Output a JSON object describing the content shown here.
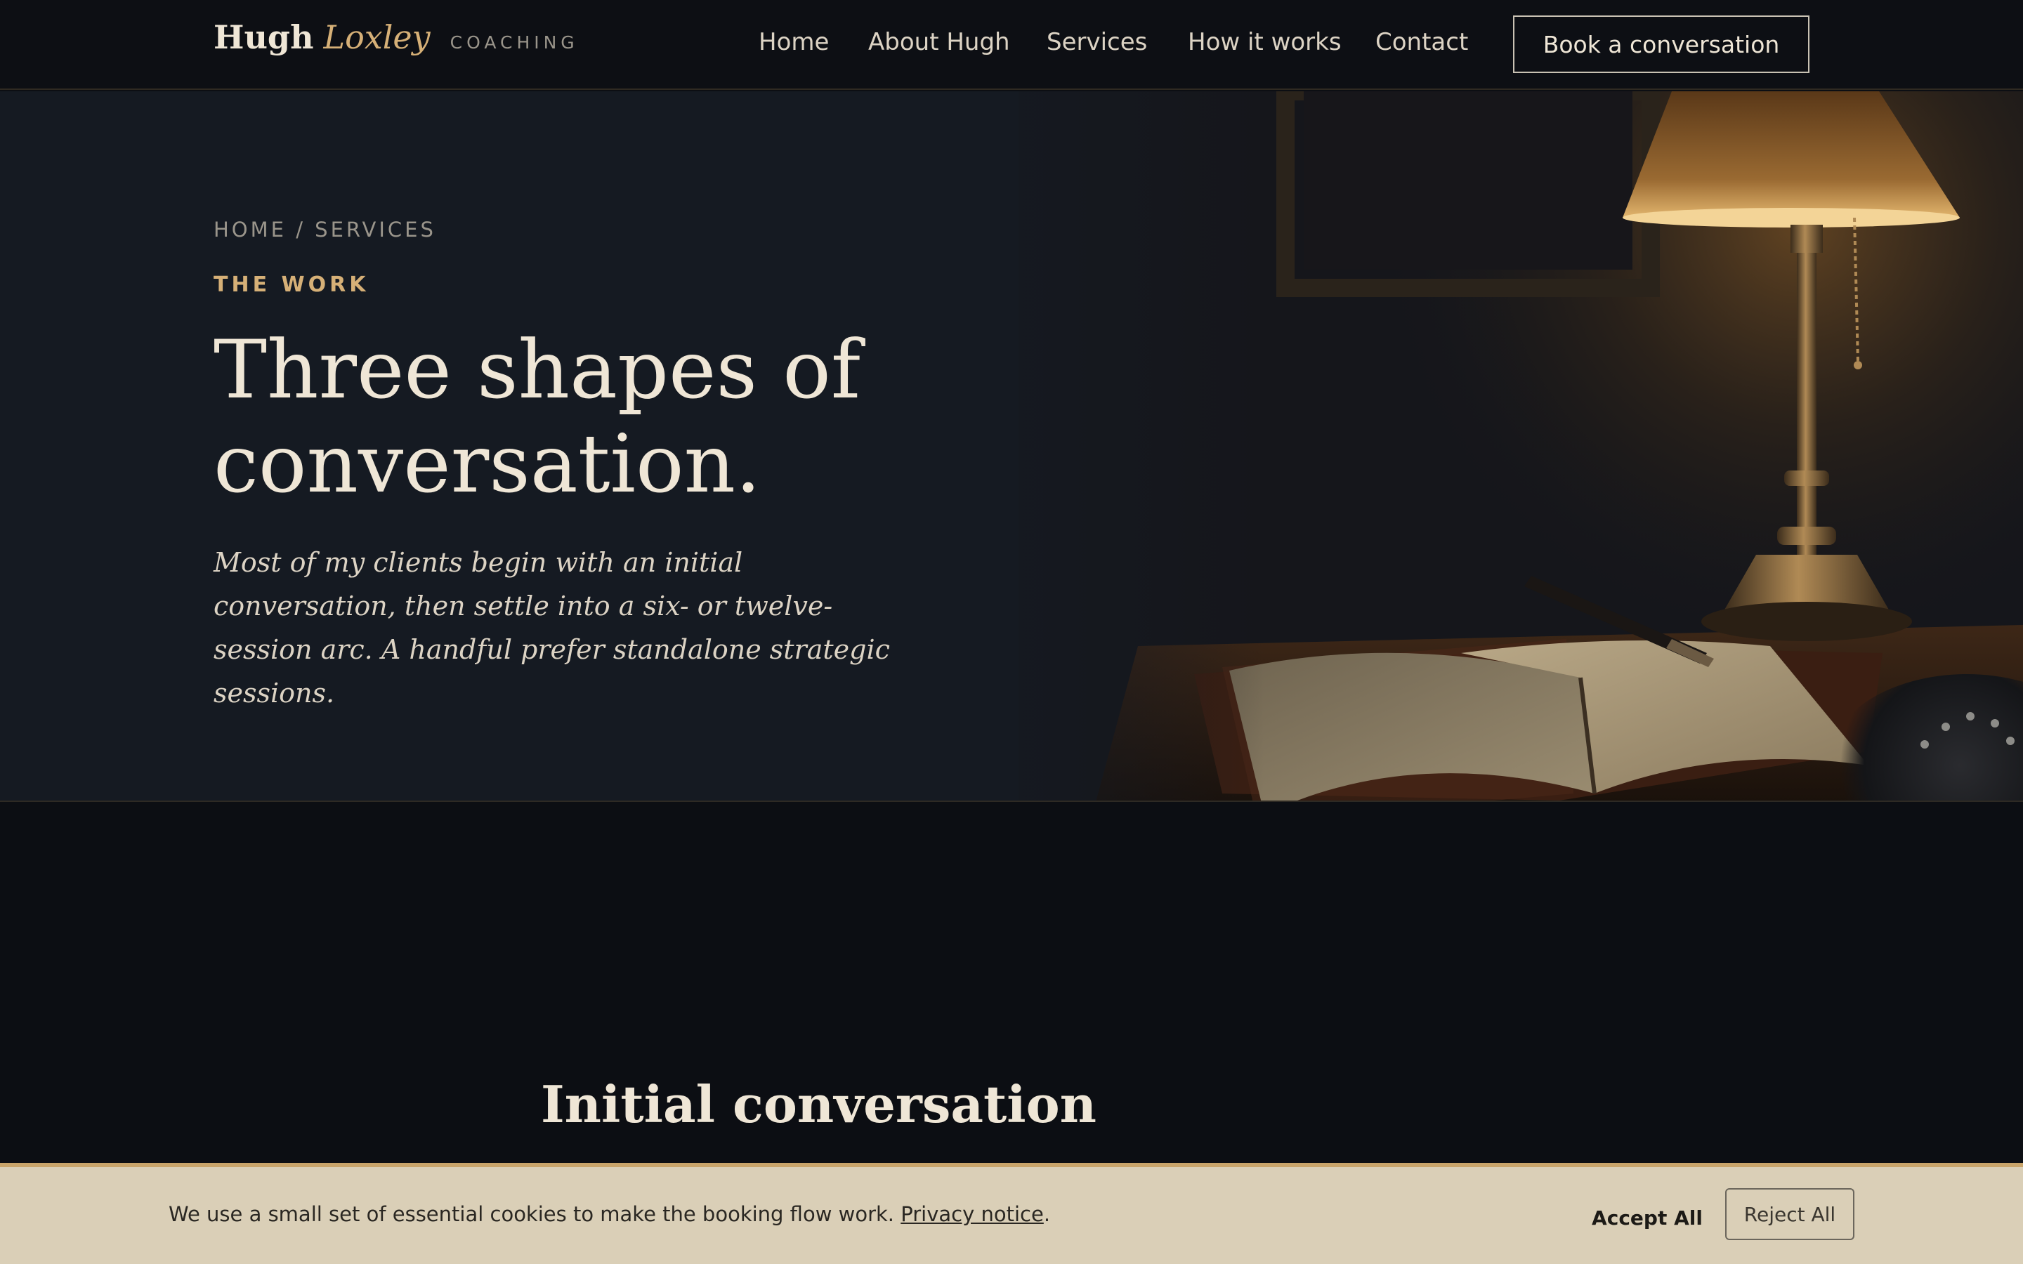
{
  "brand": {
    "first": "Hugh",
    "last": "Loxley",
    "tag": "COACHING"
  },
  "nav": {
    "items": [
      {
        "label": "Home"
      },
      {
        "label": "About Hugh"
      },
      {
        "label": "Services"
      },
      {
        "label": "How it works"
      },
      {
        "label": "Contact"
      }
    ],
    "cta_label": "Book a conversation"
  },
  "hero": {
    "breadcrumb": "HOME / SERVICES",
    "eyebrow": "THE WORK",
    "title": "Three shapes of conversation.",
    "lede": "Most of my clients begin with an initial conversation, then settle into a six- or twelve-session arc. A handful prefer standalone strategic sessions.",
    "image": "desk-lamp-journal-pen-photo"
  },
  "section": {
    "title": "Initial conversation"
  },
  "cookie": {
    "text": "We use a small set of essential cookies to make the booking flow work.",
    "link_label": "Privacy notice",
    "trail": ".",
    "accept_label": "Accept All",
    "reject_label": "Reject All"
  },
  "colors": {
    "background": "#0c0e13",
    "hero_bg": "#151a22",
    "accent_gold": "#d6b077",
    "cream_text": "#efe6d6",
    "cookie_bg": "#dacfb7"
  }
}
